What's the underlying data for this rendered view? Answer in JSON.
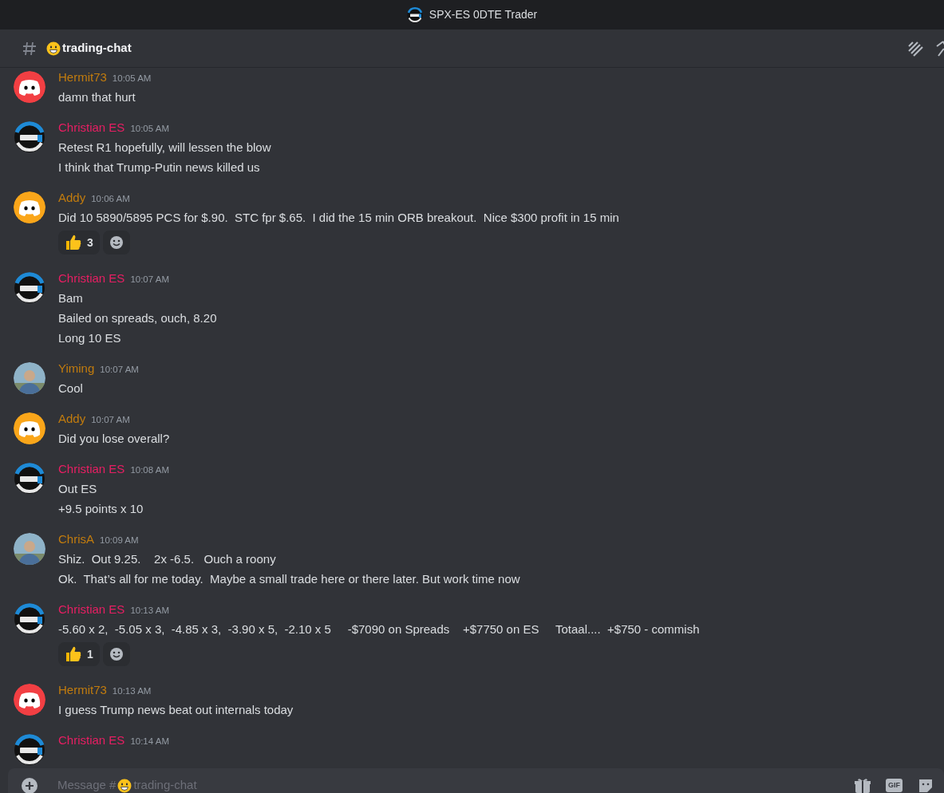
{
  "window": {
    "title": "SPX-ES 0DTE Trader"
  },
  "channel": {
    "name": "trading-chat"
  },
  "messages": [
    {
      "author": "Hermit73",
      "color": "#c27c0e",
      "avatar": {
        "kind": "discord",
        "color": "#f23f43"
      },
      "time": "10:05 AM",
      "lines": [
        "damn that hurt"
      ]
    },
    {
      "author": "Christian ES",
      "color": "#e91e63",
      "avatar": {
        "kind": "logo"
      },
      "time": "10:05 AM",
      "lines": [
        "Retest R1 hopefully, will lessen the blow",
        "I think that Trump-Putin news killed us"
      ]
    },
    {
      "author": "Addy",
      "color": "#c27c0e",
      "avatar": {
        "kind": "discord",
        "color": "#faa61a"
      },
      "time": "10:06 AM",
      "lines": [
        "Did 10 5890/5895 PCS for $.90.  STC fpr $.65.  I did the 15 min ORB breakout.  Nice $300 profit in 15 min"
      ],
      "reactions": [
        {
          "count": "3"
        }
      ]
    },
    {
      "author": "Christian ES",
      "color": "#e91e63",
      "avatar": {
        "kind": "logo"
      },
      "time": "10:07 AM",
      "lines": [
        "Bam",
        "Bailed on spreads, ouch, 8.20",
        "Long 10 ES"
      ]
    },
    {
      "author": "Yiming",
      "color": "#c27c0e",
      "avatar": {
        "kind": "picture"
      },
      "time": "10:07 AM",
      "lines": [
        "Cool"
      ]
    },
    {
      "author": "Addy",
      "color": "#c27c0e",
      "avatar": {
        "kind": "discord",
        "color": "#faa61a"
      },
      "time": "10:07 AM",
      "lines": [
        "Did you lose overall?"
      ]
    },
    {
      "author": "Christian ES",
      "color": "#e91e63",
      "avatar": {
        "kind": "logo"
      },
      "time": "10:08 AM",
      "lines": [
        "Out ES",
        "+9.5 points x 10"
      ]
    },
    {
      "author": "ChrisA",
      "color": "#c27c0e",
      "avatar": {
        "kind": "picture"
      },
      "time": "10:09 AM",
      "lines": [
        "Shiz.  Out 9.25.    2x -6.5.   Ouch a roony",
        "Ok.  That’s all for me today.  Maybe a small trade here or there later. But work time now"
      ]
    },
    {
      "author": "Christian ES",
      "color": "#e91e63",
      "avatar": {
        "kind": "logo"
      },
      "time": "10:13 AM",
      "lines": [
        "-5.60 x 2,  -5.05 x 3,  -4.85 x 3,  -3.90 x 5,  -2.10 x 5     -$7090 on Spreads    +$7750 on ES     Totaal....  +$750 - commish"
      ],
      "reactions": [
        {
          "count": "1"
        }
      ]
    },
    {
      "author": "Hermit73",
      "color": "#c27c0e",
      "avatar": {
        "kind": "discord",
        "color": "#f23f43"
      },
      "time": "10:13 AM",
      "lines": [
        "I guess Trump news beat out internals today"
      ]
    },
    {
      "author": "Christian ES",
      "color": "#e91e63",
      "avatar": {
        "kind": "logo"
      },
      "time": "10:14 AM"
    }
  ],
  "composer": {
    "placeholder_prefix": "Message #",
    "placeholder_channel": "trading-chat",
    "gif_label": "GIF"
  }
}
